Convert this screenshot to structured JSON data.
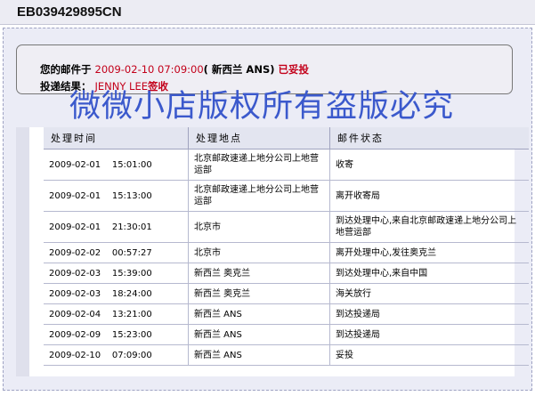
{
  "header": {
    "tracking_number": "EB039429895CN"
  },
  "status": {
    "prefix": "您的邮件于",
    "datetime": "2009-02-10 07:09:00",
    "destination": "( 新西兰  ANS)",
    "state": "已妥投",
    "result_label": "投递结果：",
    "signer_name": "JENNY LEE",
    "signer_suffix": "签收"
  },
  "watermark": "微微小店版权所有盗版必究",
  "table": {
    "headers": [
      "处理时间",
      "处理地点",
      "邮件状态"
    ],
    "rows": [
      {
        "time": "2009-02-01    15:01:00",
        "location": "北京邮政速递上地分公司上地营运部",
        "status": "收寄"
      },
      {
        "time": "2009-02-01    15:13:00",
        "location": "北京邮政速递上地分公司上地营运部",
        "status": "离开收寄局"
      },
      {
        "time": "2009-02-01    21:30:01",
        "location": "北京市",
        "status": "到达处理中心,来自北京邮政速递上地分公司上地营运部"
      },
      {
        "time": "2009-02-02    00:57:27",
        "location": "北京市",
        "status": "离开处理中心,发往奥克兰"
      },
      {
        "time": "2009-02-03    15:39:00",
        "location": "新西兰 奥克兰",
        "status": "到达处理中心,来自中国"
      },
      {
        "time": "2009-02-03    18:24:00",
        "location": "新西兰 奥克兰",
        "status": "海关放行"
      },
      {
        "time": "2009-02-04    13:21:00",
        "location": "新西兰 ANS",
        "status": "到达投递局"
      },
      {
        "time": "2009-02-09    15:23:00",
        "location": "新西兰 ANS",
        "status": "到达投递局"
      },
      {
        "time": "2009-02-10    07:09:00",
        "location": "新西兰 ANS",
        "status": "妥投"
      }
    ]
  }
}
